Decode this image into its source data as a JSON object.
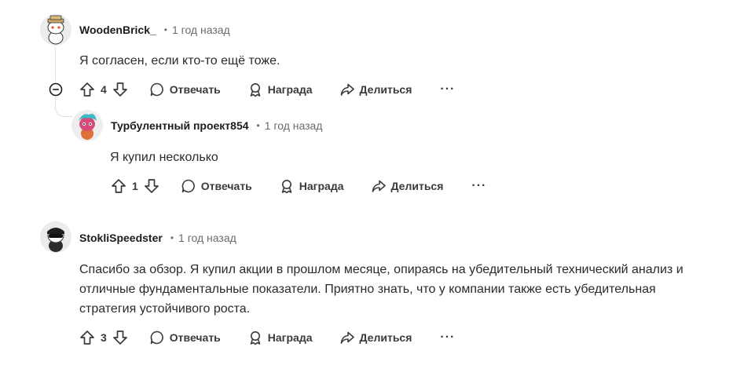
{
  "comments": [
    {
      "author": "WoodenBrick_",
      "time": "1 год назад",
      "text": "Я согласен, если кто-то ещё тоже.",
      "score": "4",
      "reply_label": "Отвечать",
      "award_label": "Награда",
      "share_label": "Делиться",
      "more_label": "···"
    },
    {
      "author": "Турбулентный проект854",
      "time": "1 год назад",
      "text": "Я купил несколько",
      "score": "1",
      "reply_label": "Отвечать",
      "award_label": "Награда",
      "share_label": "Делиться",
      "more_label": "···"
    },
    {
      "author": "StokliSpeedster",
      "time": "1 год назад",
      "text_lines": [
        "Спасибо за обзор. Я купил акции в прошлом месяце, опираясь на убедительный технический анализ и",
        "отличные фундаментальные показатели. Приятно знать, что у компании также есть убедительная",
        "стратегия устойчивого роста."
      ],
      "score": "3",
      "reply_label": "Отвечать",
      "award_label": "Награда",
      "share_label": "Делиться",
      "more_label": "···"
    }
  ],
  "separator": "•",
  "colors": {
    "text": "#1c1c1c",
    "muted": "#6b6b6b",
    "icon": "#3a3a3a",
    "thread_line": "#e0e0e0"
  },
  "icons": [
    "upvote-icon",
    "downvote-icon",
    "comment-icon",
    "award-icon",
    "share-icon",
    "collapse-icon"
  ]
}
